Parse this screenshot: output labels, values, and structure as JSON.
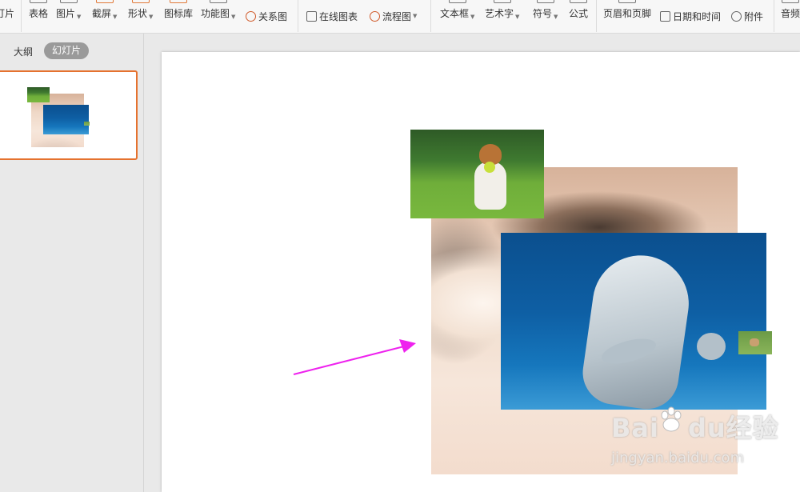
{
  "ribbon": {
    "slide_partial": "灯片",
    "items": [
      {
        "label": "表格",
        "icon": "table-icon",
        "caret": false
      },
      {
        "label": "图片",
        "icon": "image-icon",
        "caret": true
      },
      {
        "label": "截屏",
        "icon": "screenshot-icon",
        "caret": true
      },
      {
        "label": "形状",
        "icon": "shape-icon",
        "caret": true
      },
      {
        "label": "图标库",
        "icon": "icon-library-icon",
        "caret": false
      },
      {
        "label": "功能图",
        "icon": "function-chart-icon",
        "caret": true
      },
      {
        "label": "关系图",
        "icon": "relation-chart-icon",
        "caret": false
      },
      {
        "label": "在线图表",
        "icon": "online-chart-icon",
        "caret": false
      },
      {
        "label": "流程图",
        "icon": "flowchart-icon",
        "caret": true
      },
      {
        "label": "文本框",
        "icon": "textbox-icon",
        "caret": true
      },
      {
        "label": "艺术字",
        "icon": "wordart-icon",
        "caret": true
      },
      {
        "label": "符号",
        "icon": "symbol-icon",
        "caret": true
      },
      {
        "label": "公式",
        "icon": "formula-icon",
        "caret": false
      },
      {
        "label": "页眉和页脚",
        "icon": "header-footer-icon",
        "caret": false
      },
      {
        "label": "日期和时间",
        "icon": "datetime-icon",
        "caret": false
      },
      {
        "label": "附件",
        "icon": "attachment-icon",
        "caret": false
      },
      {
        "label": "音频",
        "icon": "audio-icon",
        "caret": false
      }
    ]
  },
  "left_panel": {
    "tab_outline": "大纲",
    "tab_slides": "幻灯片",
    "active_tab": "幻灯片"
  },
  "watermark": {
    "brand_latin": "Bai",
    "brand_rest": "du",
    "brand_cn": "经验",
    "url": "jingyan.baidu.com"
  },
  "colors": {
    "accent": "#e5722f",
    "arrow": "#ee22ee",
    "selected_tab_bg": "#9a9a9a"
  }
}
